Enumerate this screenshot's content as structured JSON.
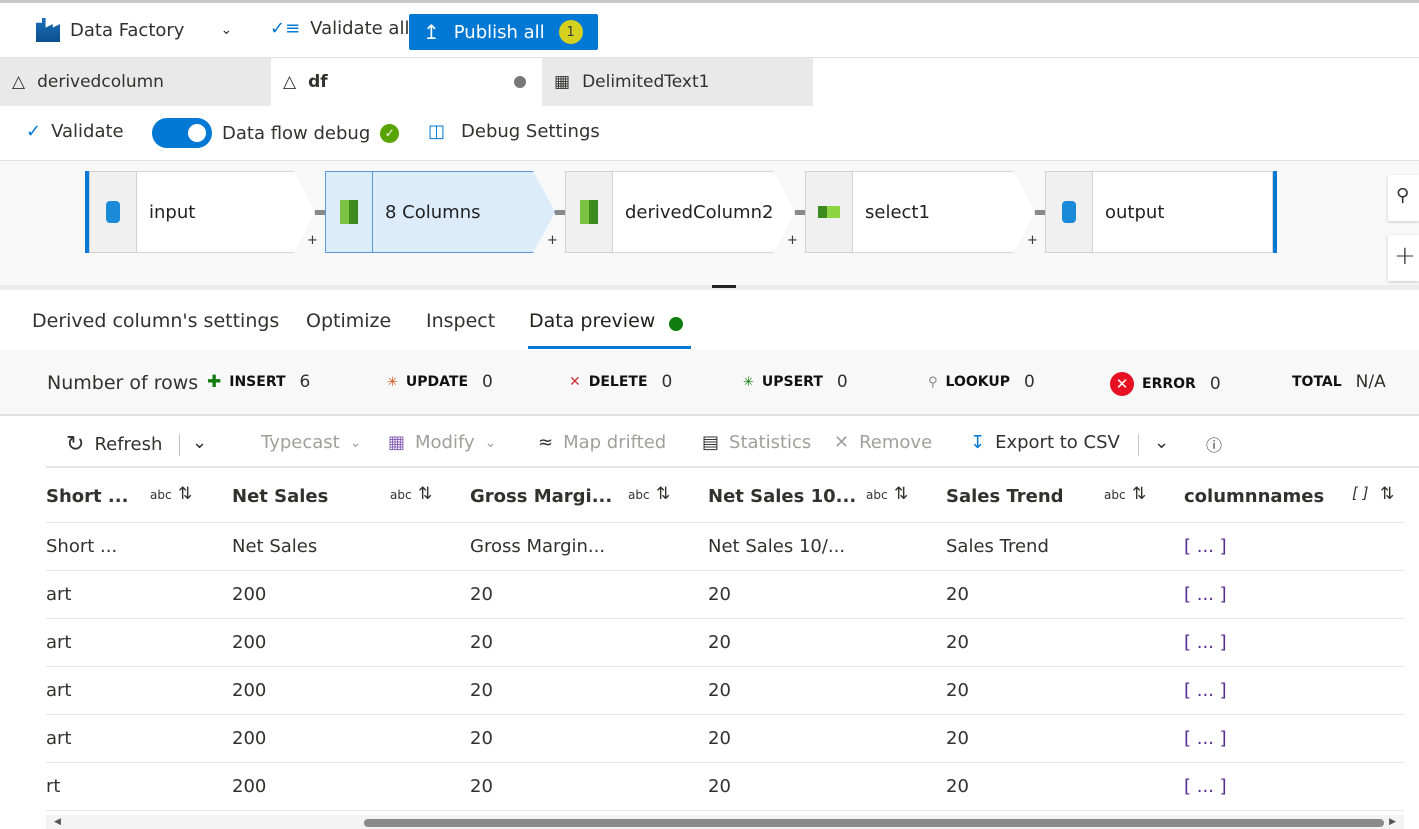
{
  "topbar": {
    "factory_label": "Data Factory",
    "validate_all": "Validate all",
    "publish_all": "Publish all",
    "publish_count": "1"
  },
  "file_tabs": [
    {
      "label": "derivedcolumn"
    },
    {
      "label": "df",
      "active": true,
      "unsaved": true
    },
    {
      "label": "DelimitedText1"
    }
  ],
  "toolbar": {
    "validate": "Validate",
    "debug_label": "Data flow debug",
    "debug_on": true,
    "debug_settings": "Debug Settings"
  },
  "flow": {
    "nodes": [
      {
        "label": "input"
      },
      {
        "label": "8 Columns",
        "selected": true
      },
      {
        "label": "derivedColumn2"
      },
      {
        "label": "select1"
      },
      {
        "label": "output"
      }
    ],
    "plus": "+"
  },
  "bottom_tabs": [
    {
      "label": "Derived column's settings"
    },
    {
      "label": "Optimize"
    },
    {
      "label": "Inspect"
    },
    {
      "label": "Data preview",
      "active": true
    }
  ],
  "stats": {
    "label": "Number of rows",
    "items": [
      {
        "name": "INSERT",
        "value": "6"
      },
      {
        "name": "UPDATE",
        "value": "0"
      },
      {
        "name": "DELETE",
        "value": "0"
      },
      {
        "name": "UPSERT",
        "value": "0"
      },
      {
        "name": "LOOKUP",
        "value": "0"
      },
      {
        "name": "ERROR",
        "value": "0"
      },
      {
        "name": "TOTAL",
        "value": "N/A"
      }
    ]
  },
  "grid_toolbar": {
    "refresh": "Refresh",
    "typecast": "Typecast",
    "modify": "Modify",
    "map_drifted": "Map drifted",
    "statistics": "Statistics",
    "remove": "Remove",
    "export": "Export to CSV"
  },
  "table": {
    "columns": [
      {
        "name": "Short ...",
        "type": "abc"
      },
      {
        "name": "Net Sales",
        "type": "abc"
      },
      {
        "name": "Gross Margi...",
        "type": "abc"
      },
      {
        "name": "Net Sales 10...",
        "type": "abc"
      },
      {
        "name": "Sales Trend",
        "type": "abc"
      },
      {
        "name": "columnnames",
        "type": "[ ]"
      }
    ],
    "rows": [
      [
        "Short ...",
        "Net Sales",
        "Gross Margin...",
        "Net Sales 10/...",
        "Sales Trend",
        "[ ... ]"
      ],
      [
        "art",
        "200",
        "20",
        "20",
        "20",
        "[ ... ]"
      ],
      [
        "art",
        "200",
        "20",
        "20",
        "20",
        "[ ... ]"
      ],
      [
        "art",
        "200",
        "20",
        "20",
        "20",
        "[ ... ]"
      ],
      [
        "art",
        "200",
        "20",
        "20",
        "20",
        "[ ... ]"
      ],
      [
        "rt",
        "200",
        "20",
        "20",
        "20",
        "[ ... ]"
      ]
    ]
  },
  "colors": {
    "accent": "#0078d4",
    "success": "#107c10",
    "error": "#e81123",
    "selected_node": "#dcecfb"
  }
}
